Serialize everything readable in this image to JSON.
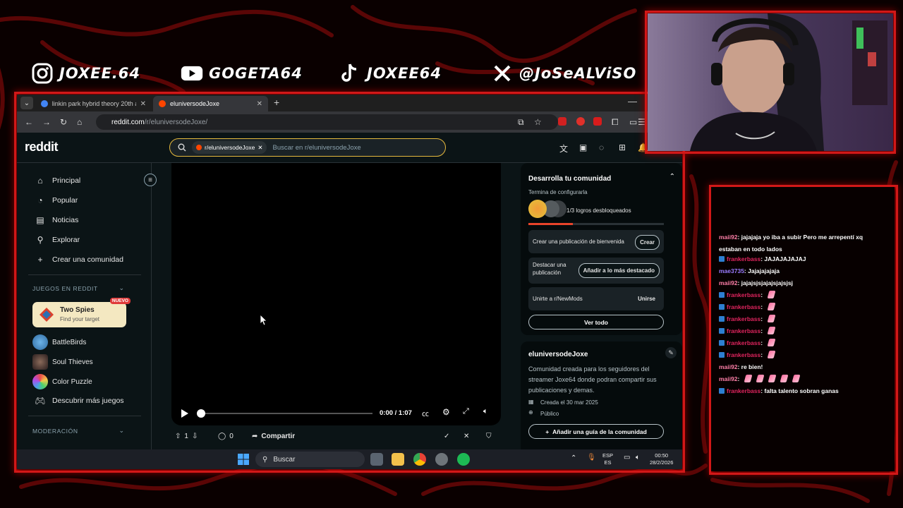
{
  "socials": [
    {
      "icon": "instagram-icon",
      "handle": "JOXEE.64"
    },
    {
      "icon": "youtube-icon",
      "handle": "GOGETA64"
    },
    {
      "icon": "tiktok-icon",
      "handle": "JOXEE64"
    },
    {
      "icon": "x-icon",
      "handle": "@JoSeALViSO"
    }
  ],
  "browser": {
    "tabs": [
      {
        "title": "linkin park hybrid theory 20th a",
        "active": false
      },
      {
        "title": "eluniversodeJoxe",
        "active": true
      }
    ],
    "url_host": "reddit.com",
    "url_path": "/r/eluniversodeJoxe/"
  },
  "reddit": {
    "logo": "reddit",
    "search_chip": "r/eluniversodeJoxe",
    "search_placeholder": "Buscar en r/eluniversodeJoxe",
    "nav": [
      {
        "icon": "home-icon",
        "label": "Principal"
      },
      {
        "icon": "popular-icon",
        "label": "Popular"
      },
      {
        "icon": "news-icon",
        "label": "Noticias"
      },
      {
        "icon": "explore-icon",
        "label": "Explorar"
      },
      {
        "icon": "plus-icon",
        "label": "Crear una comunidad"
      }
    ],
    "games_header": "JUEGOS EN REDDIT",
    "featured_game": {
      "title": "Two Spies",
      "subtitle": "Find your target",
      "badge": "NUEVO"
    },
    "games": [
      "BattleBirds",
      "Soul Thieves",
      "Color Puzzle"
    ],
    "discover_games": "Descubrir más juegos",
    "moderation_header": "MODERACIÓN",
    "video": {
      "time": "0:00 / 1:07",
      "progress": 0
    },
    "post_actions": {
      "votes": "1",
      "comments": "0",
      "share": "Compartir"
    },
    "community_card": {
      "title": "Desarrolla tu comunidad",
      "subtitle": "Termina de configurarla",
      "achievements": "1/3 logros desbloqueados",
      "progress": 0.33,
      "tasks": [
        {
          "label": "Crear una publicación de bienvenida",
          "button": "Crear"
        },
        {
          "label": "Destacar una publicación",
          "button": "Añadir a lo más destacado"
        },
        {
          "label": "Unirte a r/NewMods",
          "button": "Unirse"
        }
      ],
      "see_all": "Ver todo"
    },
    "about": {
      "name": "eluniversodeJoxe",
      "description": "Comunidad creada para los seguidores del streamer Joxe64 donde podran compartir sus publicaciones y demas.",
      "created": "Creada el 30 mar 2025",
      "visibility": "Público",
      "guide_button": "Añadir una guía de la comunidad"
    }
  },
  "taskbar": {
    "search": "Buscar",
    "lang1": "ESP",
    "lang2": "ES",
    "time": "00:50",
    "date": "28/2/2026"
  },
  "chat": [
    {
      "user": "maii92",
      "color": "#ff7fa8",
      "text": ": jajajaja yo iba a subir Pero me arrepentí xq estaban en todo lados",
      "badge": false
    },
    {
      "user": "frankerbass",
      "color": "#e0245e",
      "text": ": JAJAJAJAJAJ",
      "badge": true
    },
    {
      "user": "mae3735",
      "color": "#9b7bff",
      "text": ": Jajajajajaja",
      "badge": false
    },
    {
      "user": "maii92",
      "color": "#ff7fa8",
      "text": ": jajajsjsjajajsjajsjsj",
      "badge": false
    },
    {
      "user": "frankerbass",
      "color": "#e0245e",
      "text": ":",
      "badge": true,
      "emote": true
    },
    {
      "user": "frankerbass",
      "color": "#e0245e",
      "text": ":",
      "badge": true,
      "emote": true
    },
    {
      "user": "frankerbass",
      "color": "#e0245e",
      "text": ":",
      "badge": true,
      "emote": true
    },
    {
      "user": "frankerbass",
      "color": "#e0245e",
      "text": ":",
      "badge": true,
      "emote": true
    },
    {
      "user": "frankerbass",
      "color": "#e0245e",
      "text": ":",
      "badge": true,
      "emote": true
    },
    {
      "user": "frankerbass",
      "color": "#e0245e",
      "text": ":",
      "badge": true,
      "emote": true
    },
    {
      "user": "maii92",
      "color": "#ff7fa8",
      "text": ": re bien!",
      "badge": false
    },
    {
      "user": "maii92",
      "color": "#ff7fa8",
      "text": ":",
      "badge": false,
      "emotes": 5
    },
    {
      "user": "frankerbass",
      "color": "#e0245e",
      "text": ": falta talento sobran ganas",
      "badge": true
    }
  ],
  "colors": {
    "frame": "#d11818",
    "reddit_bg": "#0b1416",
    "search_border": "#e5b93d"
  }
}
